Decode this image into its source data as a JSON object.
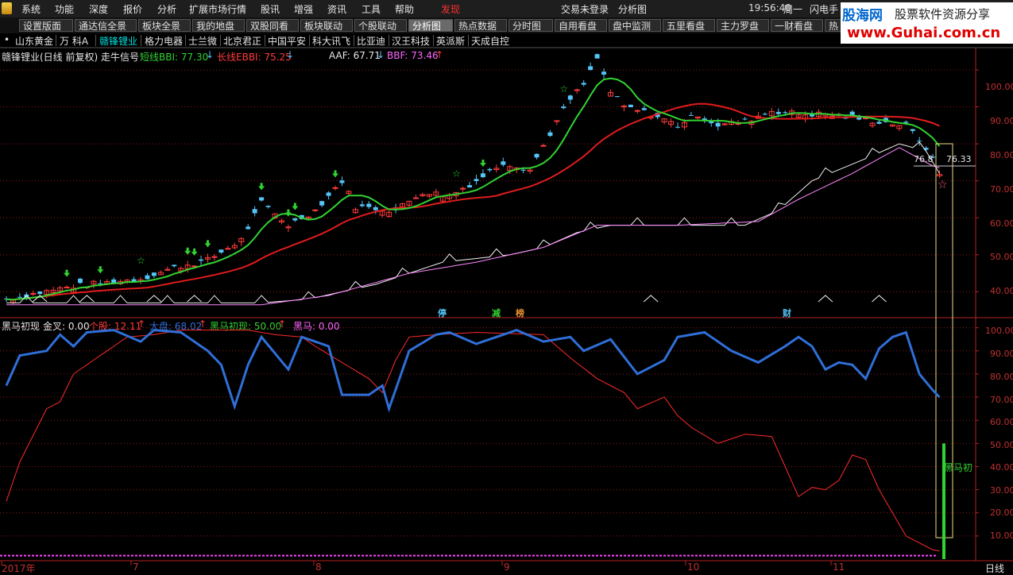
{
  "menu": {
    "items": [
      "系统",
      "功能",
      "深度",
      "报价",
      "分析",
      "扩展市场行情",
      "股讯",
      "增强",
      "资讯",
      "工具",
      "帮助"
    ],
    "highlight": "发现",
    "center_left": "交易未登录",
    "center_right": "分析图",
    "clock": "19:56:40",
    "weekday": "周一",
    "right_item": "闪电手"
  },
  "watermark": {
    "brand": "股海网",
    "slogan": "股票软件资源分享",
    "url": "www.Guhai.com.cn"
  },
  "tabs": [
    "设置版面",
    "通达信全景",
    "板块全景",
    "我的地盘",
    "双股同看",
    "板块联动",
    "个股联动",
    "分析图",
    "热点数据",
    "分时图",
    "自用看盘",
    "盘中监测",
    "五里看盘",
    "主力罗盘",
    "一财看盘",
    "热"
  ],
  "active_tab": "分析图",
  "stocks": {
    "prefix": "•",
    "items": [
      "山东黄金",
      "万 科A",
      "赣锋锂业",
      "格力电器",
      "士兰微",
      "北京君正",
      "中国平安",
      "科大讯飞",
      "比亚迪",
      "汉王科技",
      "英派斯",
      "天成自控"
    ],
    "active": "赣锋锂业"
  },
  "main_chart": {
    "title": "赣锋锂业(日线 前复权) 走牛信号",
    "bbi_label": "短线BBI: 77.30",
    "bbi_arrow": "↓",
    "ebbi_label": "长线EBBI: 75.25",
    "ebbi_arrow": "↓",
    "aaf_label": "AAF: 67.71",
    "aaf_arrow": "↓",
    "bbf_label": "BBF: 73.46",
    "bbf_arrow": "↑",
    "price_tag": "76.33",
    "price_tag_prefix": "76.8",
    "markers": [
      "停",
      "减",
      "榜",
      "财"
    ],
    "yticks": [
      "100.00",
      "90.00",
      "80.00",
      "70.00",
      "60.00",
      "50.00",
      "40.00"
    ]
  },
  "sub_chart": {
    "name": "黑马初现",
    "jincha": "金叉: 0.00",
    "gegu": "个股: 12.11",
    "gegu_arrow": "↑",
    "dapan": "大盘: 68.02",
    "dapan_arrow": "↑",
    "heima_chuxian": "黑马初现: 50.00",
    "heima_arrow": "↑",
    "heima": "黑马: 0.00",
    "bar_label": "黑马初",
    "yticks": [
      "100.00",
      "90.00",
      "80.00",
      "70.00",
      "60.00",
      "50.00",
      "40.00",
      "30.00",
      "20.00",
      "10.00"
    ]
  },
  "xaxis": {
    "labels": [
      "2017年",
      "7",
      "8",
      "9",
      "10",
      "11"
    ],
    "period": "日线"
  },
  "colors": {
    "up": "#ff3b3b",
    "down": "#54c5f8",
    "bbi": "#32d232",
    "ebbi": "#e01c1c",
    "blue_line": "#2f6fd8",
    "grid": "#8b1a1a",
    "highlight_box": "#e8e080"
  },
  "chart_data": [
    {
      "type": "candlestick",
      "title": "赣锋锂业(日线 前复权) 走牛信号",
      "ylim": [
        33,
        106
      ],
      "yticks": [
        40,
        50,
        60,
        70,
        80,
        90,
        100
      ],
      "series": [
        {
          "name": "短线BBI",
          "last": 77.3
        },
        {
          "name": "长线EBBI",
          "last": 75.25
        },
        {
          "name": "AAF",
          "last": 67.71
        },
        {
          "name": "BBF",
          "last": 73.46
        }
      ]
    },
    {
      "type": "line",
      "title": "黑马初现",
      "ylim": [
        0,
        104
      ],
      "yticks": [
        10,
        20,
        30,
        40,
        50,
        60,
        70,
        80,
        90,
        100
      ],
      "series": [
        {
          "name": "个股",
          "last": 12.11
        },
        {
          "name": "大盘",
          "last": 68.02
        },
        {
          "name": "黑马初现",
          "last": 50.0
        },
        {
          "name": "黑马",
          "last": 0.0
        }
      ]
    }
  ]
}
